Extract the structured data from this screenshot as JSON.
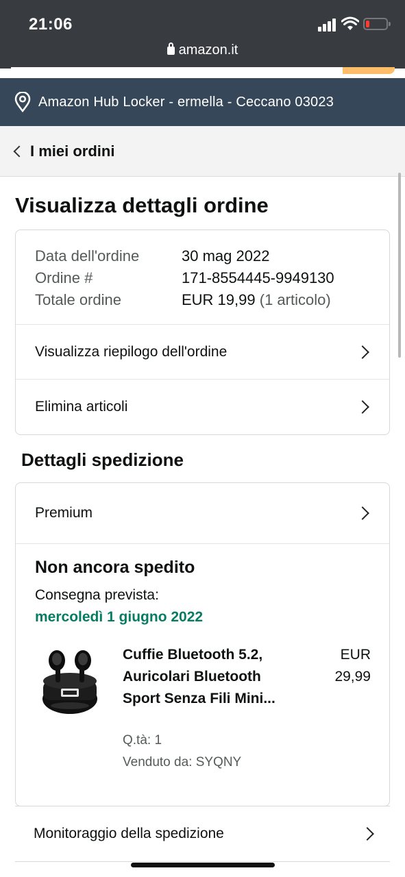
{
  "status_bar": {
    "time": "21:06",
    "url": "amazon.it",
    "icons": [
      "signal-icon",
      "wifi-icon",
      "battery-low-icon"
    ]
  },
  "location": {
    "text": "Amazon Hub Locker - ermella - Ceccano 03023",
    "icon": "location-pin-icon"
  },
  "breadcrumb": {
    "label": "I miei ordini"
  },
  "page": {
    "title": "Visualizza dettagli ordine"
  },
  "order_info": {
    "date_label": "Data dell'ordine",
    "date_value": "30 mag 2022",
    "number_label": "Ordine #",
    "number_value": "171-8554445-9949130",
    "total_label": "Totale ordine",
    "total_value": "EUR 19,99",
    "total_items": "(1 articolo)"
  },
  "order_links": {
    "summary": "Visualizza riepilogo dell'ordine",
    "delete": "Elimina articoli"
  },
  "shipping": {
    "section_title": "Dettagli spedizione",
    "method": "Premium",
    "status": "Non ancora spedito",
    "eta_label": "Consegna prevista:",
    "eta_date": "mercoledì 1 giugno 2022",
    "product": {
      "title": "Cuffie Bluetooth 5.2, Auricolari Bluetooth Sport Senza Fili Mini...",
      "price": "EUR 29,99",
      "quantity": "Q.tà: 1",
      "seller": "Venduto da: SYQNY"
    },
    "tracking_label": "Monitoraggio della spedizione"
  },
  "colors": {
    "status_bar_bg": "#383b3f",
    "location_bg": "#37475a",
    "eta_green": "#067d62",
    "search_button": "#febd69"
  }
}
